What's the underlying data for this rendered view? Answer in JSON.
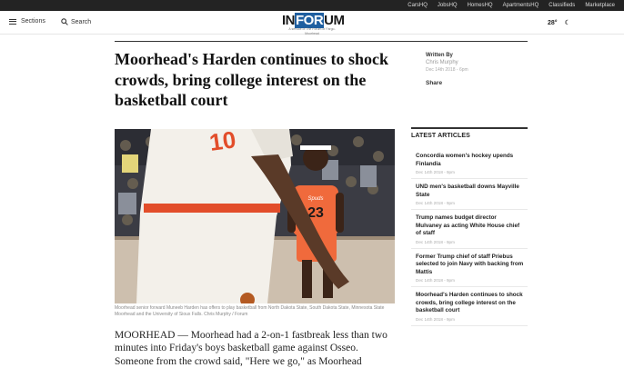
{
  "topbar": {
    "links": [
      "CarsHQ",
      "JobsHQ",
      "HomesHQ",
      "ApartmentsHQ",
      "Classifieds",
      "Marketplace"
    ]
  },
  "header": {
    "sections_label": "Sections",
    "search_label": "Search",
    "logo_word": "INFORUM",
    "logo_tagline": "A service of The Forum of Fargo-Moorhead",
    "temperature": "28°"
  },
  "article": {
    "headline": "Moorhead's Harden continues to shock crowds, bring college interest on the basketball court",
    "byline_label": "Written By",
    "author": "Chris Murphy",
    "date": "Dec 14th 2018 - 6pm",
    "share_label": "Share",
    "caption": "Moorhead senior forward Muneeb Harden has offers to play basketball from North Dakota State, South Dakota State, Minnesota State Moorhead and the University of Sioux Falls. Chris Murphy / Forum",
    "jersey_front": "10",
    "jersey_back": "23",
    "jersey_team": "Spuds",
    "body_text": "MOORHEAD — Moorhead had a 2-on-1 fastbreak less than two minutes into Friday's boys basketball game against Osseo. Someone from the crowd said, \"Here we go,\" as Moorhead"
  },
  "latest": {
    "title": "LATEST ARTICLES",
    "items": [
      {
        "title": "Concordia women's hockey upends Finlandia",
        "date": "Dec 14th 2018 - 9pm"
      },
      {
        "title": "UND men's basketball downs Mayville State",
        "date": "Dec 14th 2018 - 9pm"
      },
      {
        "title": "Trump names budget director Mulvaney as acting White House chief of staff",
        "date": "Dec 14th 2018 - 9pm"
      },
      {
        "title": "Former Trump chief of staff Priebus selected to join Navy with backing from Mattis",
        "date": "Dec 14th 2018 - 9pm"
      },
      {
        "title": "Moorhead's Harden continues to shock crowds, bring college interest on the basketball court",
        "date": "Dec 14th 2018 - 9pm"
      }
    ]
  }
}
